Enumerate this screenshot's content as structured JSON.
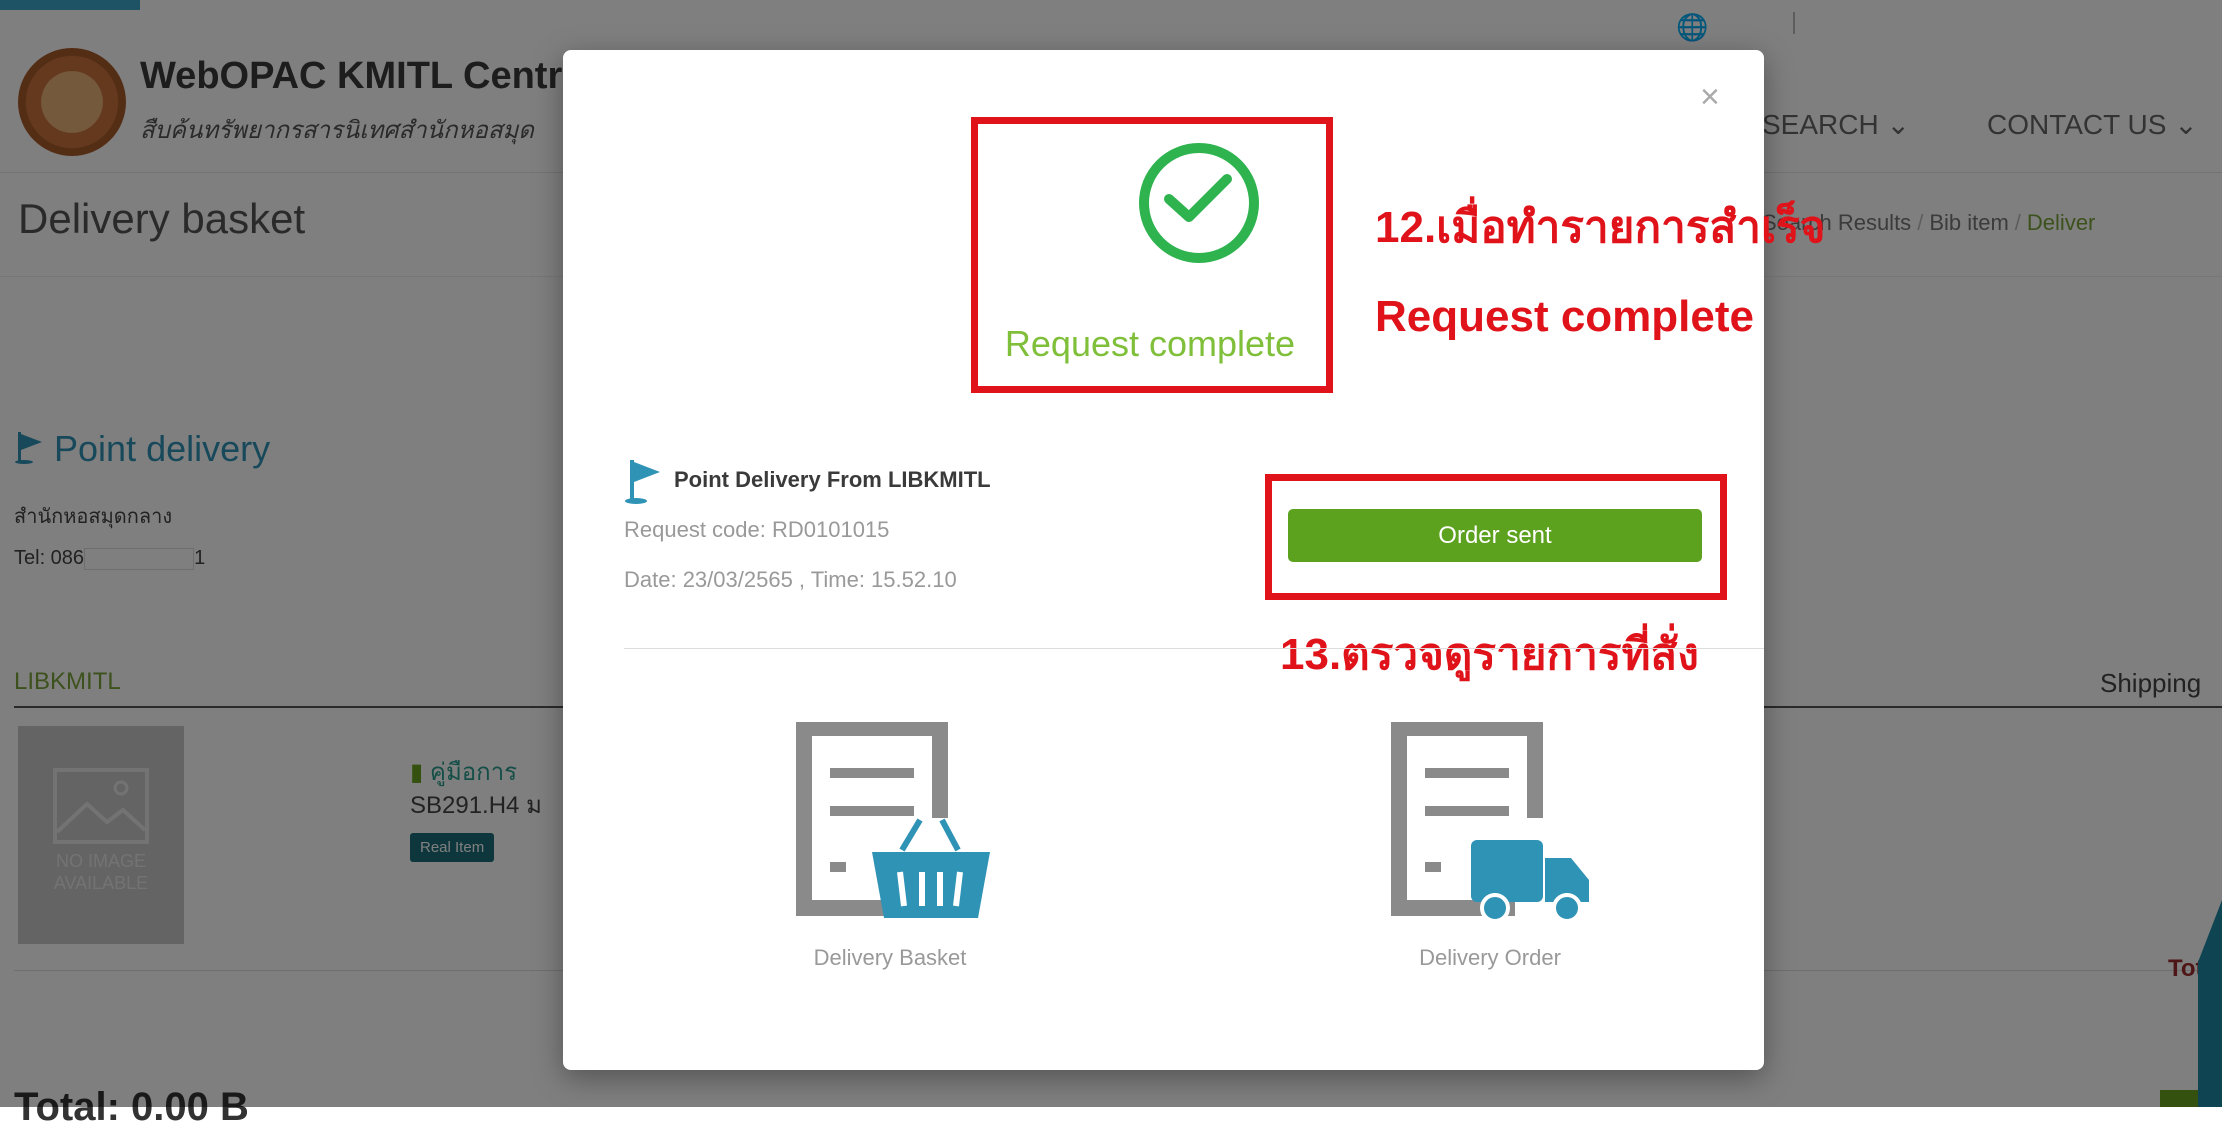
{
  "header": {
    "site_title": "WebOPAC KMITL Central",
    "site_subtitle": "สืบค้นทรัพยากรสารนิเทศสำนักหอสมุด",
    "nav": {
      "search": "SEARCH ⌄",
      "contact": "CONTACT US ⌄"
    }
  },
  "page": {
    "title": "Delivery basket",
    "breadcrumb": {
      "search_results": "Search Results",
      "bib_item": "Bib item",
      "current": "Deliver"
    }
  },
  "point_delivery": {
    "heading": "Point delivery",
    "location": "สำนักหอสมุดกลาง",
    "tel_prefix": "Tel: 086",
    "tel_suffix": "1"
  },
  "library": {
    "label": "LIBKMITL",
    "shipping_label": "Shipping",
    "no_image": "NO IMAGE AVAILABLE",
    "item_title": "คู่มือการ",
    "item_call": "SB291.H4 ม",
    "item_badge": "Real Item",
    "total_label": "Total",
    "total_left": "Total: 0.00 B"
  },
  "modal": {
    "close": "×",
    "request_complete": "Request complete",
    "point_delivery_from": "Point Delivery From LIBKMITL",
    "request_code": "Request code: RD0101015",
    "date_time": "Date: 23/03/2565 , Time: 15.52.10",
    "order_button": "Order sent",
    "delivery_basket": "Delivery Basket",
    "delivery_order": "Delivery Order"
  },
  "annotations": {
    "step12_line1": "12.เมื่อทำรายการสำเร็จ",
    "step12_line2": "Request complete",
    "step13": "13.ตรวจดูรายการที่สั่ง"
  },
  "colors": {
    "success_green": "#2eb34f",
    "button_green": "#5da21f",
    "annotation_red": "#e0121a",
    "accent_blue": "#2f93b6"
  }
}
